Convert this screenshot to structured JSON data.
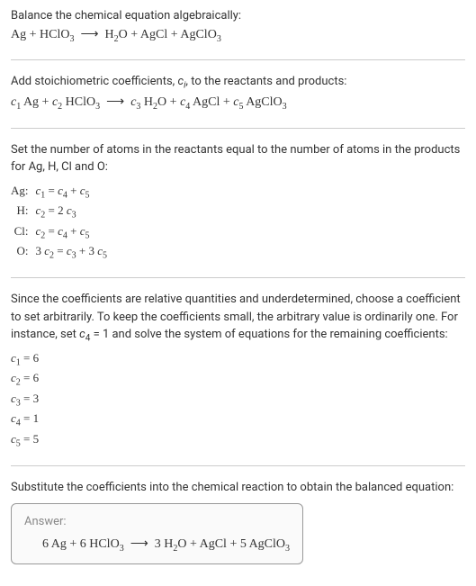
{
  "title": "Balance the chemical equation algebraically:",
  "equation_unbalanced_html": "Ag + HClO<span class=\"sub\">3</span> &nbsp;⟶&nbsp; H<span class=\"sub\">2</span>O + AgCl + AgClO<span class=\"sub\">3</span>",
  "stoich_text_html": "Add stoichiometric coefficients, <span class=\"italic\">c<span class=\"sub\">i</span></span>, to the reactants and products:",
  "stoich_eq_html": "<span class=\"italic\">c</span><span class=\"sub\">1</span> Ag + <span class=\"italic\">c</span><span class=\"sub\">2</span> HClO<span class=\"sub\">3</span> &nbsp;⟶&nbsp; <span class=\"italic\">c</span><span class=\"sub\">3</span> H<span class=\"sub\">2</span>O + <span class=\"italic\">c</span><span class=\"sub\">4</span> AgCl + <span class=\"italic\">c</span><span class=\"sub\">5</span> AgClO<span class=\"sub\">3</span>",
  "atoms_text": "Set the number of atoms in the reactants equal to the number of atoms in the products for Ag, H, Cl and O:",
  "atoms": [
    {
      "label": "Ag:",
      "eq_html": "<span class=\"italic\">c</span><span class=\"sub\">1</span> = <span class=\"italic\">c</span><span class=\"sub\">4</span> + <span class=\"italic\">c</span><span class=\"sub\">5</span>"
    },
    {
      "label": "H:",
      "eq_html": "<span class=\"italic\">c</span><span class=\"sub\">2</span> = 2 <span class=\"italic\">c</span><span class=\"sub\">3</span>"
    },
    {
      "label": "Cl:",
      "eq_html": "<span class=\"italic\">c</span><span class=\"sub\">2</span> = <span class=\"italic\">c</span><span class=\"sub\">4</span> + <span class=\"italic\">c</span><span class=\"sub\">5</span>"
    },
    {
      "label": "O:",
      "eq_html": "3 <span class=\"italic\">c</span><span class=\"sub\">2</span> = <span class=\"italic\">c</span><span class=\"sub\">3</span> + 3 <span class=\"italic\">c</span><span class=\"sub\">5</span>"
    }
  ],
  "underdet_text_html": "Since the coefficients are relative quantities and underdetermined, choose a coefficient to set arbitrarily. To keep the coefficients small, the arbitrary value is ordinarily one. For instance, set <span class=\"italic\">c</span><span class=\"sub\">4</span> = 1 and solve the system of equations for the remaining coefficients:",
  "coefs": [
    "<span class=\"italic\">c</span><span class=\"sub\">1</span> = 6",
    "<span class=\"italic\">c</span><span class=\"sub\">2</span> = 6",
    "<span class=\"italic\">c</span><span class=\"sub\">3</span> = 3",
    "<span class=\"italic\">c</span><span class=\"sub\">4</span> = 1",
    "<span class=\"italic\">c</span><span class=\"sub\">5</span> = 5"
  ],
  "subst_text": "Substitute the coefficients into the chemical reaction to obtain the balanced equation:",
  "answer_label": "Answer:",
  "answer_eq_html": "6 Ag + 6 HClO<span class=\"sub\">3</span> &nbsp;⟶&nbsp; 3 H<span class=\"sub\">2</span>O + AgCl + 5 AgClO<span class=\"sub\">3</span>"
}
